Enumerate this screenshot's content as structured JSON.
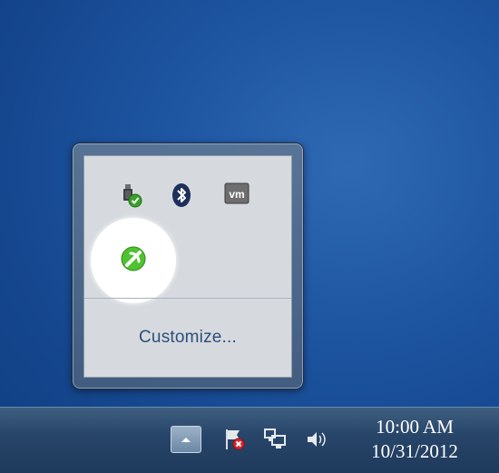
{
  "notification_overflow": {
    "customize_label": "Customize...",
    "icons": [
      {
        "name": "safely-remove-hardware-icon"
      },
      {
        "name": "bluetooth-icon"
      },
      {
        "name": "vmware-icon",
        "text": "vm"
      },
      {
        "name": "app-tray-icon",
        "highlighted": true
      }
    ]
  },
  "taskbar": {
    "clock": {
      "time": "10:00 AM",
      "date": "10/31/2012"
    },
    "tray_icons": [
      "show-hidden-icons-button",
      "action-center-icon",
      "network-icon",
      "volume-icon"
    ]
  },
  "colors": {
    "desktop": "#1f57a3",
    "taskbar": "#28466a",
    "popup_panel": "#d6dadf",
    "link": "#2d4f78",
    "highlight": "#ffffff",
    "app_icon_green": "#4ec230"
  }
}
